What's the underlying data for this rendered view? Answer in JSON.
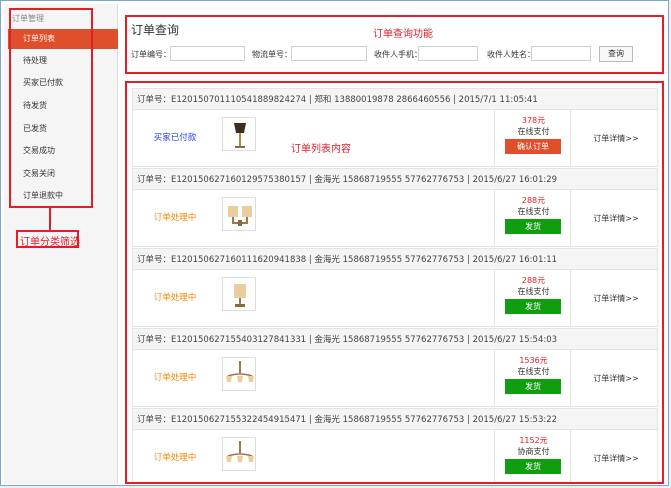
{
  "sidebar": {
    "title": "订单管理",
    "items": [
      {
        "label": "订单列表",
        "active": true
      },
      {
        "label": "待处理"
      },
      {
        "label": "买家已付款"
      },
      {
        "label": "待发货"
      },
      {
        "label": "已发货"
      },
      {
        "label": "交易成功"
      },
      {
        "label": "交易关闭"
      },
      {
        "label": "订单退款中"
      }
    ]
  },
  "query": {
    "title": "订单查询",
    "fields": [
      {
        "label": "订单编号：",
        "value": ""
      },
      {
        "label": "物流单号：",
        "value": ""
      },
      {
        "label": "收件人手机：",
        "value": ""
      },
      {
        "label": "收件人姓名：",
        "value": ""
      }
    ],
    "button_label": "查询"
  },
  "annotations": {
    "query_note": "订单查询功能",
    "list_note": "订单列表内容",
    "filter_note": "订单分类筛选"
  },
  "orders": [
    {
      "header": "订单号：E1201507011105418898242​74  |  郑和  13880019878  2866460556  |  2015/7/1 11:05:41",
      "status": "买家已付款",
      "status_color": "#2b3fd6",
      "price": "378元",
      "pay_method": "在线支付",
      "action": "确认订单",
      "action_type": "confirm",
      "detail": "订单详情>>",
      "thumb": "floor-lamp"
    },
    {
      "header": "订单号：E1201506271601295753801​57  |  金海光  15868719555  57762776753  |  2015/6/27 16:01:29",
      "status": "订单处理中",
      "status_color": "#f08a00",
      "price": "288元",
      "pay_method": "在线支付",
      "action": "发货",
      "action_type": "ship",
      "detail": "订单详情>>",
      "thumb": "wall-lamp"
    },
    {
      "header": "订单号：E1201506271601116209418​38  |  金海光  15868719555  57762776753  |  2015/6/27 16:01:11",
      "status": "订单处理中",
      "status_color": "#f08a00",
      "price": "288元",
      "pay_method": "在线支付",
      "action": "发货",
      "action_type": "ship",
      "detail": "订单详情>>",
      "thumb": "wall-lamp-single"
    },
    {
      "header": "订单号：E1201506271554031278413​31  |  金海光  15868719555  57762776753  |  2015/6/27 15:54:03",
      "status": "订单处理中",
      "status_color": "#f08a00",
      "price": "1536元",
      "pay_method": "在线支付",
      "action": "发货",
      "action_type": "ship",
      "detail": "订单详情>>",
      "thumb": "chandelier"
    },
    {
      "header": "订单号：E1201506271553224549154​71  |  金海光  15868719555  57762776753  |  2015/6/27 15:53:22",
      "status": "订单处理中",
      "status_color": "#f08a00",
      "price": "1152元",
      "pay_method": "协商支付",
      "action": "发货",
      "action_type": "ship",
      "detail": "订单详情>>",
      "thumb": "chandelier"
    }
  ]
}
